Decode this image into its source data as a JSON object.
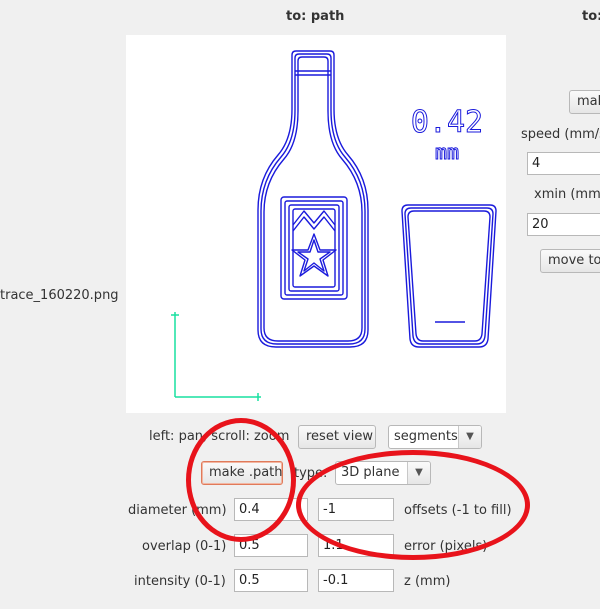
{
  "panel_title": "to: path",
  "right_panel": {
    "title": "to:",
    "make_button": "mak",
    "speed_label": "speed (mm/s",
    "speed_value": "4",
    "xmin_label": "xmin (mm)",
    "xmin_value": "20",
    "move_button": "move to"
  },
  "left_panel": {
    "file_name": "trace_160220.png"
  },
  "canvas": {
    "measure_value": "0.42",
    "measure_unit": "mm"
  },
  "view_controls": {
    "hint": "left: pan, scroll: zoom",
    "reset_button": "reset view",
    "view_select": "segments"
  },
  "path_controls": {
    "make_button": "make .path",
    "type_label": "type:",
    "type_select": "3D plane"
  },
  "params": {
    "diameter_label": "diameter (mm)",
    "diameter_value": "0.4",
    "offsets_value": "-1",
    "offsets_label": "offsets (-1 to fill)",
    "overlap_label": "overlap (0-1)",
    "overlap_value": "0.5",
    "error_value": "1.1",
    "error_label": "error (pixels)",
    "intensity_label": "intensity (0-1)",
    "intensity_value": "0.5",
    "z_value": "-0.1",
    "z_label": "z (mm)"
  },
  "colors": {
    "toolpath": "#1a1adc",
    "axes": "#18e0a0",
    "annotation": "#e8131b"
  }
}
